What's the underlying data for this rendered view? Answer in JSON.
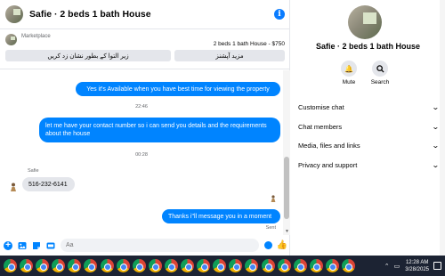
{
  "chat": {
    "title": "Safie · 2 beds 1 bath House",
    "marketplace": {
      "label": "Marketplace",
      "listing": "2 beds 1 bath House - $750",
      "button_left": "زیر التوا کے بطور نشان زد کریں",
      "button_right": "مزید آپشنز"
    },
    "messages": {
      "m1": "Yes it's Available when you have best time for viewing the property",
      "ts1": "22:46",
      "m2": "let me have your contact number so i can send you details and the requirements about the house",
      "ts2": "00:28",
      "sender": "Safie",
      "m3": "516-232-6141",
      "m4": "Thanks i\"ll message you in a moment",
      "status": "Sent"
    },
    "composer": {
      "placeholder": "Aa"
    }
  },
  "side": {
    "title": "Safie · 2 beds 1 bath House",
    "actions": {
      "mute": "Mute",
      "search": "Search"
    },
    "rows": {
      "customise": "Customise chat",
      "members": "Chat members",
      "media": "Media, files and links",
      "privacy": "Privacy and support"
    }
  },
  "taskbar": {
    "time": "12:28 AM",
    "date": "3/28/2025"
  },
  "colors": {
    "accent": "#0084ff",
    "bubble_in": "#e4e6eb",
    "taskbar": "#1c2333"
  }
}
